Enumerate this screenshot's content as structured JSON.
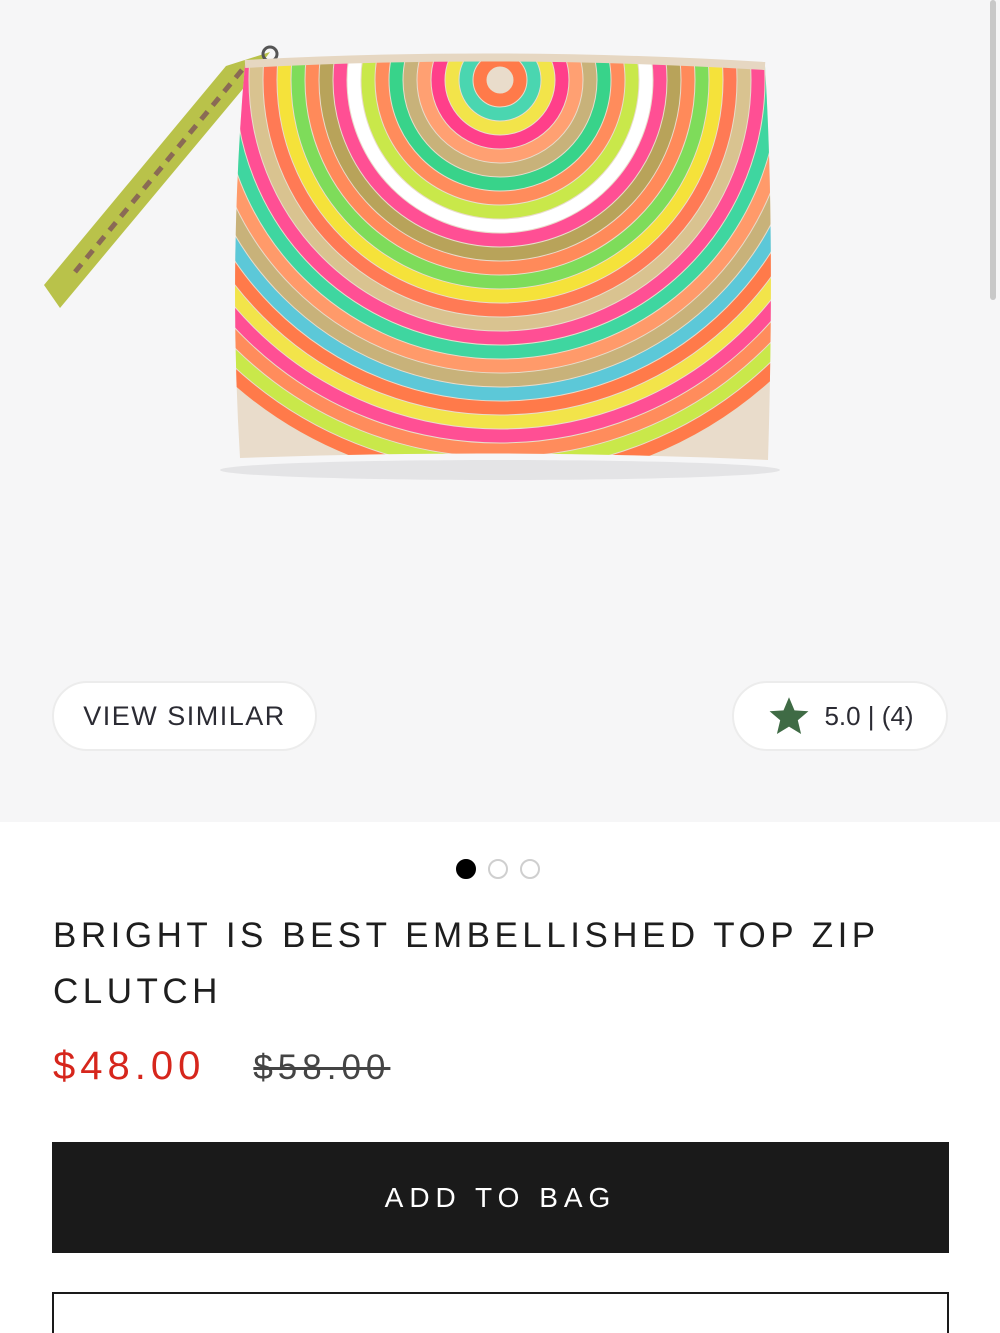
{
  "gallery": {
    "image_alt": "Embellished beaded rainbow clutch",
    "active_slide": 1,
    "slide_count": 3
  },
  "actions": {
    "view_similar_label": "VIEW SIMILAR"
  },
  "rating": {
    "summary": "5.0 | (4)",
    "star_color": "#3f6b45",
    "icon": "star-icon"
  },
  "product": {
    "title": "BRIGHT IS BEST EMBELLISHED TOP ZIP CLUTCH",
    "sale_price": "$48.00",
    "original_price": "$58.00",
    "sale_color": "#d6261c"
  },
  "cart": {
    "add_to_bag_label": "ADD TO BAG"
  }
}
